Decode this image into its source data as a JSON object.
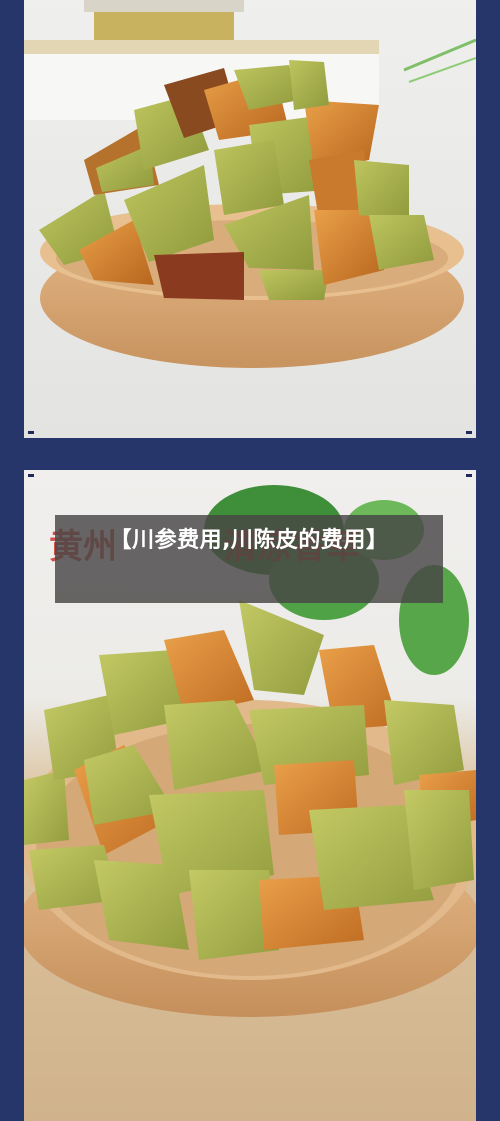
{
  "caption": {
    "title": "【川参费用,川陈皮的费用】"
  },
  "photo_top": {
    "subject": "tangerine-peel-cubes-in-wooden-bowl"
  },
  "photo_bottom": {
    "subject": "tangerine-peel-pieces-in-wooden-bowl",
    "background_lettering": "黄州 清凉香草"
  },
  "colors": {
    "frame": "#26356a",
    "caption_background": "#484646",
    "peel_green": "#a5b04c",
    "peel_orange": "#d88a2f",
    "wood": "#d9aa78"
  }
}
